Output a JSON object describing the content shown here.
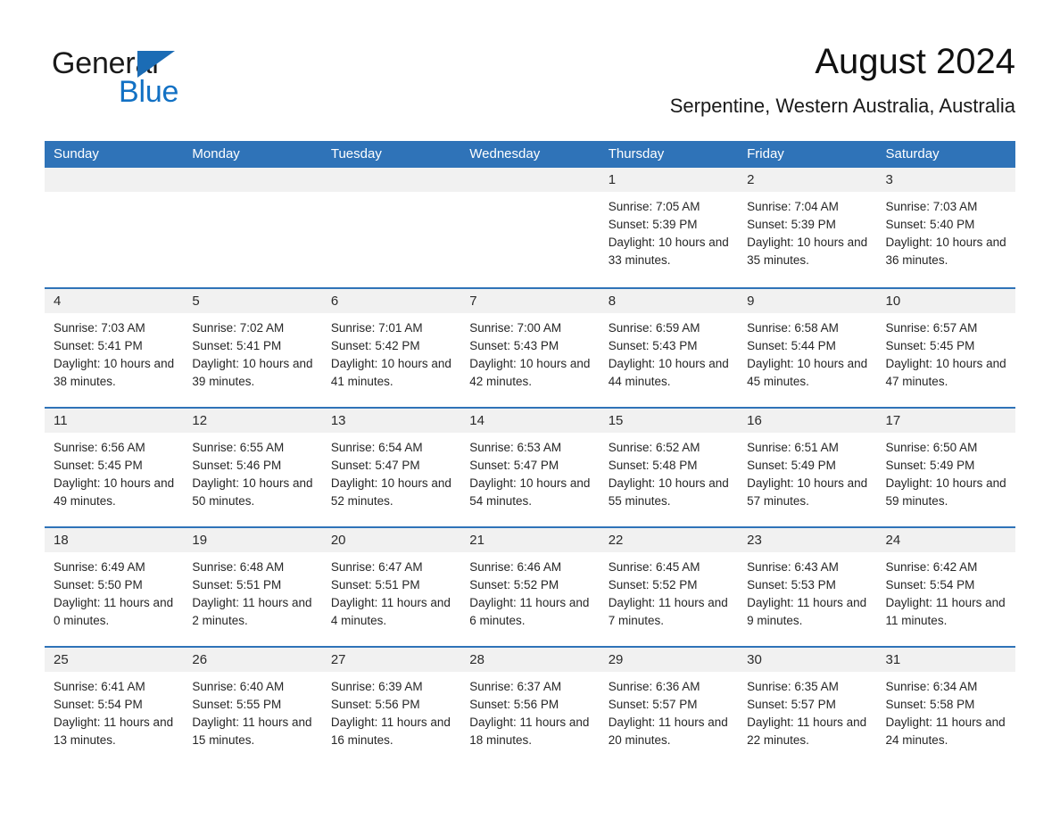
{
  "brand": {
    "word_one": "General",
    "word_two": "Blue",
    "triangle_icon": "brand-triangle-icon",
    "accent_color": "#1b6cb5",
    "blue_text_color": "#1271c4"
  },
  "header": {
    "month_title": "August 2024",
    "location": "Serpentine, Western Australia, Australia"
  },
  "theme": {
    "header_blue": "#2f73b8",
    "daynum_band": "#f1f1f1",
    "text": "#262626"
  },
  "calendar": {
    "weekday_headers": [
      "Sunday",
      "Monday",
      "Tuesday",
      "Wednesday",
      "Thursday",
      "Friday",
      "Saturday"
    ],
    "weeks": [
      [
        {
          "day": "",
          "empty": true
        },
        {
          "day": "",
          "empty": true
        },
        {
          "day": "",
          "empty": true
        },
        {
          "day": "",
          "empty": true
        },
        {
          "day": "1",
          "sunrise": "Sunrise: 7:05 AM",
          "sunset": "Sunset: 5:39 PM",
          "daylight": "Daylight: 10 hours and 33 minutes."
        },
        {
          "day": "2",
          "sunrise": "Sunrise: 7:04 AM",
          "sunset": "Sunset: 5:39 PM",
          "daylight": "Daylight: 10 hours and 35 minutes."
        },
        {
          "day": "3",
          "sunrise": "Sunrise: 7:03 AM",
          "sunset": "Sunset: 5:40 PM",
          "daylight": "Daylight: 10 hours and 36 minutes."
        }
      ],
      [
        {
          "day": "4",
          "sunrise": "Sunrise: 7:03 AM",
          "sunset": "Sunset: 5:41 PM",
          "daylight": "Daylight: 10 hours and 38 minutes."
        },
        {
          "day": "5",
          "sunrise": "Sunrise: 7:02 AM",
          "sunset": "Sunset: 5:41 PM",
          "daylight": "Daylight: 10 hours and 39 minutes."
        },
        {
          "day": "6",
          "sunrise": "Sunrise: 7:01 AM",
          "sunset": "Sunset: 5:42 PM",
          "daylight": "Daylight: 10 hours and 41 minutes."
        },
        {
          "day": "7",
          "sunrise": "Sunrise: 7:00 AM",
          "sunset": "Sunset: 5:43 PM",
          "daylight": "Daylight: 10 hours and 42 minutes."
        },
        {
          "day": "8",
          "sunrise": "Sunrise: 6:59 AM",
          "sunset": "Sunset: 5:43 PM",
          "daylight": "Daylight: 10 hours and 44 minutes."
        },
        {
          "day": "9",
          "sunrise": "Sunrise: 6:58 AM",
          "sunset": "Sunset: 5:44 PM",
          "daylight": "Daylight: 10 hours and 45 minutes."
        },
        {
          "day": "10",
          "sunrise": "Sunrise: 6:57 AM",
          "sunset": "Sunset: 5:45 PM",
          "daylight": "Daylight: 10 hours and 47 minutes."
        }
      ],
      [
        {
          "day": "11",
          "sunrise": "Sunrise: 6:56 AM",
          "sunset": "Sunset: 5:45 PM",
          "daylight": "Daylight: 10 hours and 49 minutes."
        },
        {
          "day": "12",
          "sunrise": "Sunrise: 6:55 AM",
          "sunset": "Sunset: 5:46 PM",
          "daylight": "Daylight: 10 hours and 50 minutes."
        },
        {
          "day": "13",
          "sunrise": "Sunrise: 6:54 AM",
          "sunset": "Sunset: 5:47 PM",
          "daylight": "Daylight: 10 hours and 52 minutes."
        },
        {
          "day": "14",
          "sunrise": "Sunrise: 6:53 AM",
          "sunset": "Sunset: 5:47 PM",
          "daylight": "Daylight: 10 hours and 54 minutes."
        },
        {
          "day": "15",
          "sunrise": "Sunrise: 6:52 AM",
          "sunset": "Sunset: 5:48 PM",
          "daylight": "Daylight: 10 hours and 55 minutes."
        },
        {
          "day": "16",
          "sunrise": "Sunrise: 6:51 AM",
          "sunset": "Sunset: 5:49 PM",
          "daylight": "Daylight: 10 hours and 57 minutes."
        },
        {
          "day": "17",
          "sunrise": "Sunrise: 6:50 AM",
          "sunset": "Sunset: 5:49 PM",
          "daylight": "Daylight: 10 hours and 59 minutes."
        }
      ],
      [
        {
          "day": "18",
          "sunrise": "Sunrise: 6:49 AM",
          "sunset": "Sunset: 5:50 PM",
          "daylight": "Daylight: 11 hours and 0 minutes."
        },
        {
          "day": "19",
          "sunrise": "Sunrise: 6:48 AM",
          "sunset": "Sunset: 5:51 PM",
          "daylight": "Daylight: 11 hours and 2 minutes."
        },
        {
          "day": "20",
          "sunrise": "Sunrise: 6:47 AM",
          "sunset": "Sunset: 5:51 PM",
          "daylight": "Daylight: 11 hours and 4 minutes."
        },
        {
          "day": "21",
          "sunrise": "Sunrise: 6:46 AM",
          "sunset": "Sunset: 5:52 PM",
          "daylight": "Daylight: 11 hours and 6 minutes."
        },
        {
          "day": "22",
          "sunrise": "Sunrise: 6:45 AM",
          "sunset": "Sunset: 5:52 PM",
          "daylight": "Daylight: 11 hours and 7 minutes."
        },
        {
          "day": "23",
          "sunrise": "Sunrise: 6:43 AM",
          "sunset": "Sunset: 5:53 PM",
          "daylight": "Daylight: 11 hours and 9 minutes."
        },
        {
          "day": "24",
          "sunrise": "Sunrise: 6:42 AM",
          "sunset": "Sunset: 5:54 PM",
          "daylight": "Daylight: 11 hours and 11 minutes."
        }
      ],
      [
        {
          "day": "25",
          "sunrise": "Sunrise: 6:41 AM",
          "sunset": "Sunset: 5:54 PM",
          "daylight": "Daylight: 11 hours and 13 minutes."
        },
        {
          "day": "26",
          "sunrise": "Sunrise: 6:40 AM",
          "sunset": "Sunset: 5:55 PM",
          "daylight": "Daylight: 11 hours and 15 minutes."
        },
        {
          "day": "27",
          "sunrise": "Sunrise: 6:39 AM",
          "sunset": "Sunset: 5:56 PM",
          "daylight": "Daylight: 11 hours and 16 minutes."
        },
        {
          "day": "28",
          "sunrise": "Sunrise: 6:37 AM",
          "sunset": "Sunset: 5:56 PM",
          "daylight": "Daylight: 11 hours and 18 minutes."
        },
        {
          "day": "29",
          "sunrise": "Sunrise: 6:36 AM",
          "sunset": "Sunset: 5:57 PM",
          "daylight": "Daylight: 11 hours and 20 minutes."
        },
        {
          "day": "30",
          "sunrise": "Sunrise: 6:35 AM",
          "sunset": "Sunset: 5:57 PM",
          "daylight": "Daylight: 11 hours and 22 minutes."
        },
        {
          "day": "31",
          "sunrise": "Sunrise: 6:34 AM",
          "sunset": "Sunset: 5:58 PM",
          "daylight": "Daylight: 11 hours and 24 minutes."
        }
      ]
    ]
  }
}
